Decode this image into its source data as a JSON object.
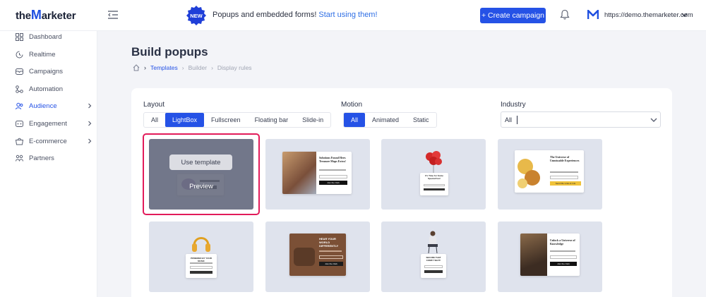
{
  "header": {
    "logo_prefix": "the",
    "logo_m": "M",
    "logo_suffix": "arketer",
    "new_badge": "NEW",
    "promo_text": "Popups and embedded forms!",
    "promo_link": "Start using them!",
    "create_button": "+ Create campaign",
    "account_url": "https://demo.themarketer.com",
    "brand_color": "#2552e6"
  },
  "sidebar": {
    "items": [
      {
        "label": "Dashboard",
        "icon": "dashboard-icon",
        "active": false,
        "has_arrow": false
      },
      {
        "label": "Realtime",
        "icon": "realtime-icon",
        "active": false,
        "has_arrow": false
      },
      {
        "label": "Campaigns",
        "icon": "campaigns-icon",
        "active": false,
        "has_arrow": false
      },
      {
        "label": "Automation",
        "icon": "automation-icon",
        "active": false,
        "has_arrow": false
      },
      {
        "label": "Audience",
        "icon": "audience-icon",
        "active": true,
        "has_arrow": true
      },
      {
        "label": "Engagement",
        "icon": "engagement-icon",
        "active": false,
        "has_arrow": true
      },
      {
        "label": "E-commerce",
        "icon": "ecommerce-icon",
        "active": false,
        "has_arrow": true
      },
      {
        "label": "Partners",
        "icon": "partners-icon",
        "active": false,
        "has_arrow": false
      }
    ]
  },
  "page": {
    "title": "Build popups",
    "breadcrumb": [
      "Templates",
      "Builder",
      "Display rules"
    ]
  },
  "filters": {
    "layout_label": "Layout",
    "layout_options": [
      "All",
      "LightBox",
      "Fullscreen",
      "Floating bar",
      "Slide-in"
    ],
    "layout_selected": "LightBox",
    "motion_label": "Motion",
    "motion_options": [
      "All",
      "Animated",
      "Static"
    ],
    "motion_selected": "All",
    "industry_label": "Industry",
    "industry_value": "All"
  },
  "tiles": {
    "hover": {
      "use_template": "Use template",
      "preview": "Preview"
    },
    "items": [
      {
        "name": "template-1"
      },
      {
        "name": "template-solutions",
        "headline": "Solutions Found Here. Treasure Maps Extra!",
        "button": "Join the Club"
      },
      {
        "name": "template-balloons",
        "headline": "It's Time for Some Special Fun!"
      },
      {
        "name": "template-universe",
        "headline": "The Universe of Unmissable Experiences",
        "button": "Send Me Links & Info"
      },
      {
        "name": "template-headphones",
        "headline": "POWERED BY YOUR MUSIC"
      },
      {
        "name": "template-hear-your-world",
        "headline": "HEAR YOUR WORLD DIFFERENTLY",
        "button": "Join the Club"
      },
      {
        "name": "template-chair",
        "headline": "SECURE THAT COMFY SEAT!"
      },
      {
        "name": "template-knowledge",
        "headline": "Unlock a Universe of Knowledge",
        "button": "Join the Club"
      }
    ]
  }
}
